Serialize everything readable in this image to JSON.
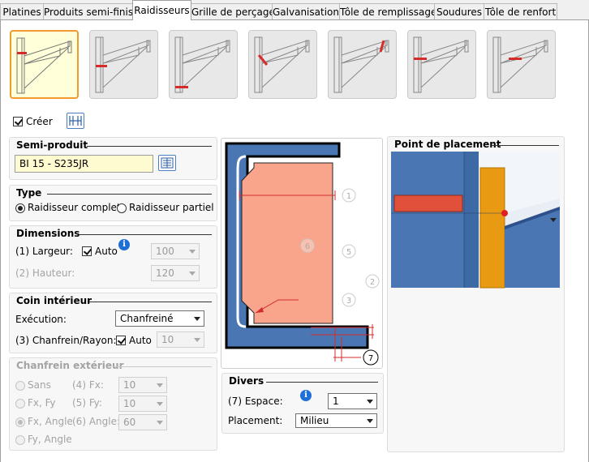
{
  "tabs": [
    "Platines",
    "Produits semi-finis",
    "Raidisseurs",
    "Grille de perçage",
    "Galvanisation",
    "Tôle de remplissage",
    "Soudures",
    "Tôle de renfort"
  ],
  "active_tab": "Raidisseurs",
  "creer": {
    "label": "Créer",
    "checked": true
  },
  "semi_produit": {
    "title": "Semi-produit",
    "value": "BI 15 - S235JR"
  },
  "type": {
    "title": "Type",
    "option1": "Raidisseur complet",
    "option2": "Raidisseur partiel",
    "selected": "Raidisseur complet"
  },
  "dimensions": {
    "title": "Dimensions",
    "largeur_label": "(1) Largeur:",
    "largeur_auto": "Auto",
    "largeur_value": "100",
    "hauteur_label": "(2) Hauteur:",
    "hauteur_value": "120"
  },
  "coin": {
    "title": "Coin intérieur",
    "execution_label": "Exécution:",
    "execution_value": "Chanfreiné",
    "chanfrein_label": "(3) Chanfrein/Rayon:",
    "chanfrein_auto": "Auto",
    "chanfrein_value": "10"
  },
  "chanfrein_ext": {
    "title": "Chanfrein extérieur",
    "sans": "Sans",
    "fxfy": "Fx, Fy",
    "fxangle": "Fx, Angle",
    "fyangle": "Fy, Angle",
    "fx_label": "(4) Fx:",
    "fx_value": "10",
    "fy_label": "(5) Fy:",
    "fy_value": "10",
    "angle_label": "(6) Angle:",
    "angle_value": "60"
  },
  "diagram": {
    "labels": [
      "1",
      "2",
      "3",
      "5",
      "6",
      "7"
    ]
  },
  "divers": {
    "title": "Divers",
    "espace_label": "(7) Espace:",
    "espace_value": "1",
    "placement_label": "Placement:",
    "placement_value": "Milieu"
  },
  "point": {
    "title": "Point de placement"
  },
  "colors": {
    "accent": "#f29a2e",
    "steel": "#4a77b4",
    "plate": "#f8a58c",
    "red": "#d62b2b",
    "orange": "#e89a12"
  }
}
